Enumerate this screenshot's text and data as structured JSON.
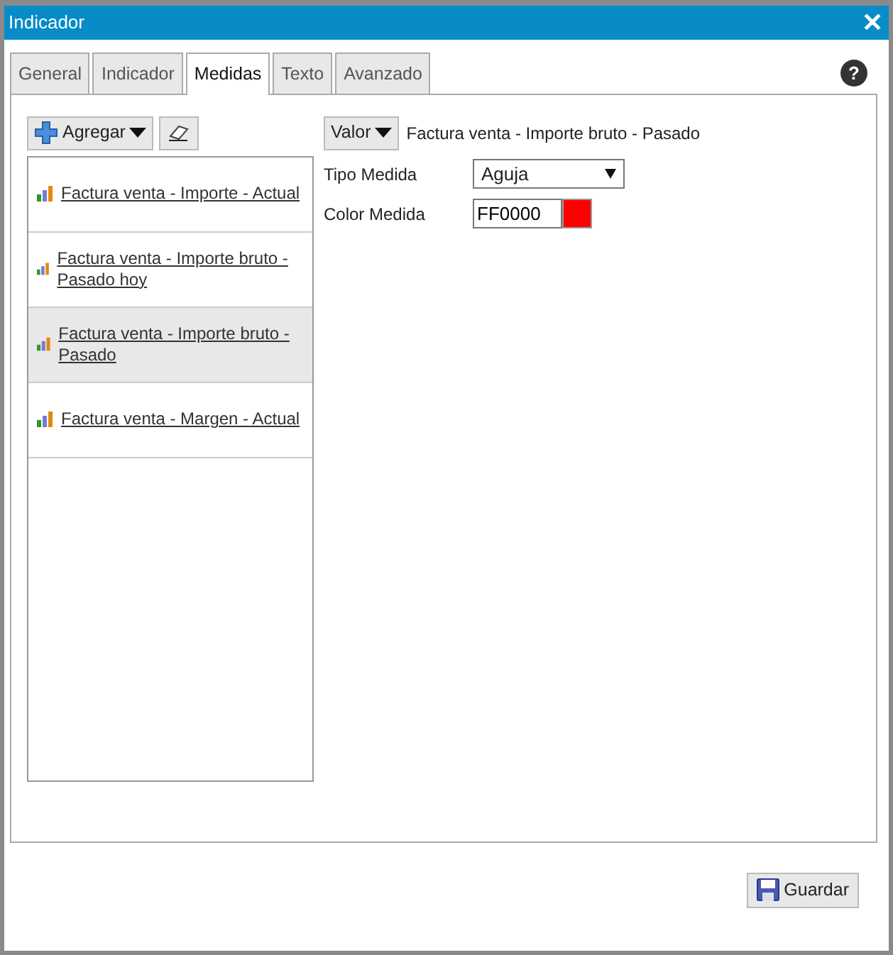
{
  "window": {
    "title": "Indicador",
    "close": "✕"
  },
  "tabs": [
    {
      "label": "General",
      "selected": false
    },
    {
      "label": "Indicador",
      "selected": false
    },
    {
      "label": "Medidas",
      "selected": true
    },
    {
      "label": "Texto",
      "selected": false
    },
    {
      "label": "Avanzado",
      "selected": false
    }
  ],
  "help": "?",
  "toolbar": {
    "add_button": "Agregar"
  },
  "measures": [
    {
      "label": "Factura venta - Importe - Actual",
      "selected": false
    },
    {
      "label": "Factura venta - Importe bruto - Pasado hoy",
      "selected": false
    },
    {
      "label": "Factura venta - Importe bruto - Pasado",
      "selected": true
    },
    {
      "label": "Factura venta - Margen - Actual",
      "selected": false
    }
  ],
  "detail": {
    "value_button": "Valor",
    "title": "Factura venta - Importe bruto - Pasado",
    "fields": [
      {
        "kind": "select",
        "label": "Tipo Medida",
        "value": "Aguja"
      },
      {
        "kind": "color",
        "label": "Color Medida",
        "value": "FF0000",
        "color": "#ff0000"
      }
    ]
  },
  "footer": {
    "save_button": "Guardar"
  }
}
